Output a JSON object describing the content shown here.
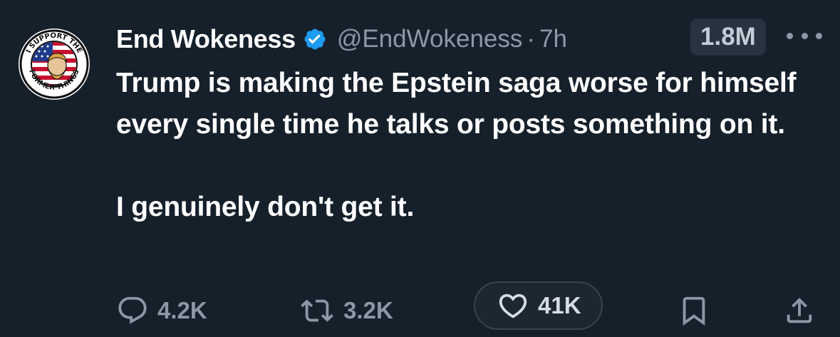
{
  "author": {
    "display_name": "End Wokeness",
    "handle": "@EndWokeness",
    "separator": "·",
    "time": "7h",
    "verified": true,
    "avatar_top_text": "I SUPPORT THE",
    "avatar_bottom_text": "FORMER THINGS"
  },
  "views": "1.8M",
  "tweet": {
    "paragraph_1": "Trump is making the Epstein saga worse for himself every single time he talks or posts something on it.",
    "paragraph_2": "I genuinely don't get it."
  },
  "actions": {
    "replies": "4.2K",
    "reposts": "3.2K",
    "likes": "41K"
  },
  "colors": {
    "background": "#15202b",
    "text": "#ffffff",
    "secondary": "#8b98a5",
    "verified": "#1d9bf0"
  },
  "icons": [
    "verified-badge-icon",
    "more-icon",
    "reply-icon",
    "repost-icon",
    "like-icon",
    "bookmark-icon",
    "share-icon"
  ]
}
